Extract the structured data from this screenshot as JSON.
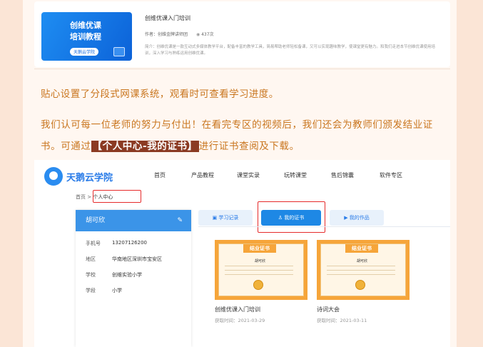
{
  "course_card": {
    "thumb_title_1": "创维优课",
    "thumb_title_2": "培训教程",
    "thumb_tag": "天鹅云学院",
    "title": "创维优课入门培训",
    "author": "作者：创维金牌讲师团",
    "views": "437次",
    "description": "简介：创维优课是一款互动式多媒体教学平台，配备丰富的教学工具，简易帮助老师轻松备课，又可以实现趣味教学，使课堂更有魅力。和我们走进本节创维优课使用培训，深入学习与熟练运用创维优课。"
  },
  "text": {
    "p1": "贴心设置了分段式网课系统，观看时可查看学习进度。",
    "p2_a": "我们认可每一位老师的努力与付出！在看完专区的视频后，我们还会为教师们颁发结业证书。可通过",
    "p2_highlight": "【个人中心-我的证书】",
    "p2_b": "进行证书查阅及下载。"
  },
  "site": {
    "brand": "天鹅云学院",
    "nav": [
      "首页",
      "产品教程",
      "课堂实录",
      "玩转课堂",
      "售后锦囊",
      "软件专区"
    ],
    "breadcrumb_home": "首页",
    "breadcrumb_sep": ">",
    "breadcrumb_current": "个人中心",
    "profile": {
      "name": "胡可欣",
      "rows": [
        {
          "label": "手机号",
          "value": "13207126200"
        },
        {
          "label": "地区",
          "value": "华南地区深圳市宝安区"
        },
        {
          "label": "学校",
          "value": "创维实验小学"
        },
        {
          "label": "学段",
          "value": "小学"
        }
      ]
    },
    "tabs": [
      "学习记录",
      "我的证书",
      "我的作品"
    ],
    "certs": [
      {
        "badge": "结业证书",
        "holder": "胡可欣",
        "course": "创维优课入门培训",
        "date": "获取时间：2021-03-29"
      },
      {
        "badge": "结业证书",
        "holder": "胡可欣",
        "course": "诗词大会",
        "date": "获取时间：2021-03-11"
      }
    ]
  }
}
